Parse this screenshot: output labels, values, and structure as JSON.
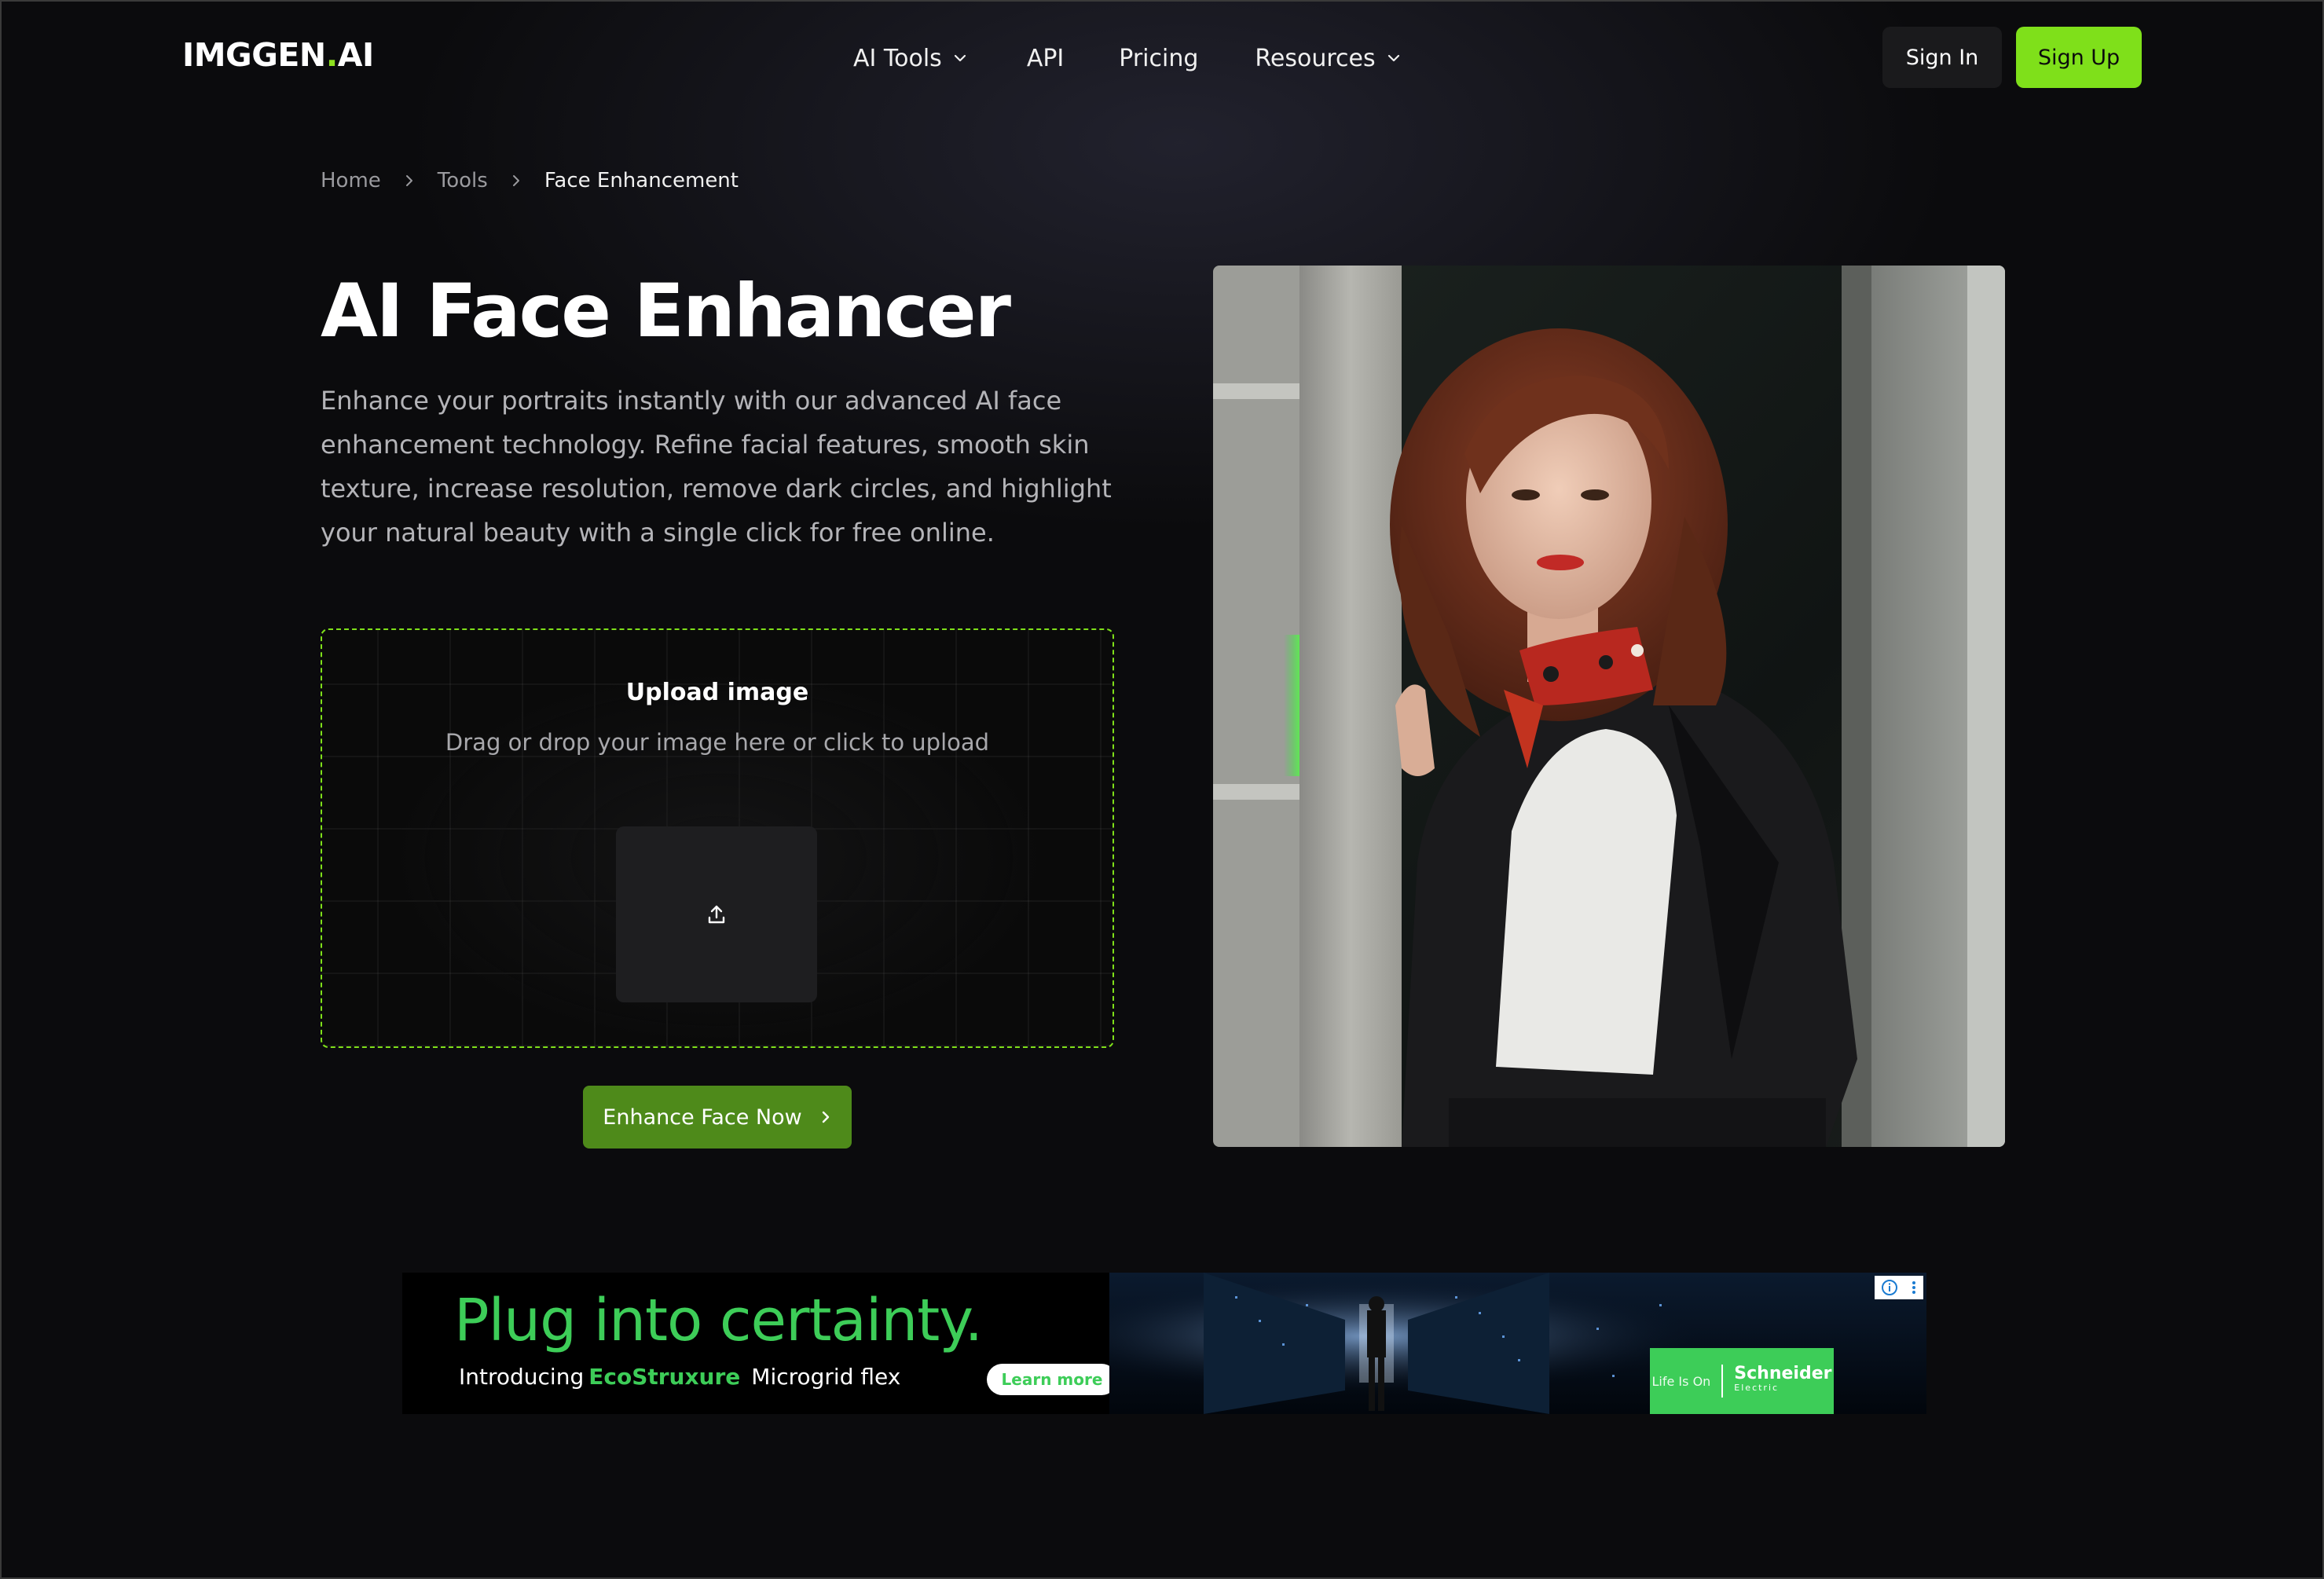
{
  "nav": {
    "logo_main": "IMGGEN",
    "logo_dot": ".",
    "logo_suffix": "AI",
    "items": [
      {
        "label": "AI Tools",
        "dropdown": true
      },
      {
        "label": "API",
        "dropdown": false
      },
      {
        "label": "Pricing",
        "dropdown": false
      },
      {
        "label": "Resources",
        "dropdown": true
      }
    ],
    "sign_in": "Sign In",
    "sign_up": "Sign Up"
  },
  "breadcrumb": {
    "items": [
      "Home",
      "Tools",
      "Face Enhancement"
    ]
  },
  "hero": {
    "title": "AI Face Enhancer",
    "description": "Enhance your portraits instantly with our advanced AI face enhancement technology. Refine facial features, smooth skin texture, increase resolution, remove dark circles, and highlight your natural beauty with a single click for free online."
  },
  "upload": {
    "title": "Upload image",
    "hint": "Drag or drop your image here or click to upload",
    "icon": "upload-icon"
  },
  "cta": {
    "label": "Enhance Face Now",
    "icon": "chevron-right-icon"
  },
  "preview": {
    "alt": "Portrait of a woman with auburn hair in a black blazer and red scarf, leaning on a doorway"
  },
  "ad": {
    "headline": "Plug into certainty.",
    "sub_prefix": "Introducing",
    "brand": "EcoStruxure",
    "sub_suffix": "Microgrid flex",
    "button": "Learn more",
    "tagline": "Life Is On",
    "advertiser": "Schneider",
    "advertiser_sub": "Electric"
  },
  "colors": {
    "accent": "#7fe01a",
    "cta": "#4e8a1a",
    "background": "#0b0b0d",
    "ad_green": "#3dcd58"
  }
}
